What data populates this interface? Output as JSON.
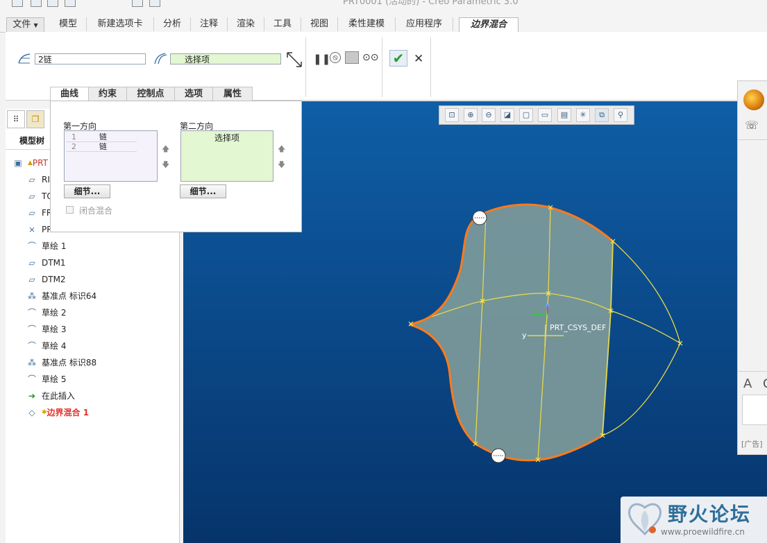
{
  "window": {
    "title": "PRT0001 (活动的) - Creo Parametric 3.0"
  },
  "ribbon_tabs": [
    {
      "label": "文件"
    },
    {
      "label": "模型"
    },
    {
      "label": "新建选项卡"
    },
    {
      "label": "分析"
    },
    {
      "label": "注释"
    },
    {
      "label": "渲染"
    },
    {
      "label": "工具"
    },
    {
      "label": "视图"
    },
    {
      "label": "柔性建模"
    },
    {
      "label": "应用程序"
    },
    {
      "label": "边界混合"
    }
  ],
  "dashboard": {
    "first_collector": "2链",
    "second_collector": "选择项"
  },
  "sub_tabs": [
    {
      "label": "曲线"
    },
    {
      "label": "约束"
    },
    {
      "label": "控制点"
    },
    {
      "label": "选项"
    },
    {
      "label": "属性"
    }
  ],
  "curves_panel": {
    "first_direction_label": "第一方向",
    "second_direction_label": "第二方向",
    "first_direction_items": [
      {
        "index": "1",
        "label": "链"
      },
      {
        "index": "2",
        "label": "链"
      }
    ],
    "second_direction_placeholder": "选择项",
    "details_label": "细节...",
    "closed_blend_label": "闭合混合"
  },
  "tree": {
    "tab_label": "模型树",
    "items": [
      {
        "label": "PRT",
        "icon": "part-icon"
      },
      {
        "label": "RI",
        "icon": "datum-plane-icon"
      },
      {
        "label": "TO",
        "icon": "datum-plane-icon"
      },
      {
        "label": "FR",
        "icon": "datum-plane-icon"
      },
      {
        "label": "PR",
        "icon": "csys-icon"
      },
      {
        "label": "草绘 1",
        "icon": "sketch-icon"
      },
      {
        "label": "DTM1",
        "icon": "datum-plane-icon"
      },
      {
        "label": "DTM2",
        "icon": "datum-plane-icon"
      },
      {
        "label": "基准点 标识64",
        "icon": "datum-point-icon"
      },
      {
        "label": "草绘 2",
        "icon": "sketch-icon"
      },
      {
        "label": "草绘 3",
        "icon": "sketch-icon"
      },
      {
        "label": "草绘 4",
        "icon": "sketch-icon"
      },
      {
        "label": "基准点 标识88",
        "icon": "datum-point-icon"
      },
      {
        "label": "草绘 5",
        "icon": "sketch-icon"
      },
      {
        "label": "在此插入",
        "icon": "insert-arrow-icon"
      },
      {
        "label": "边界混合 1",
        "icon": "boundary-blend-icon"
      }
    ]
  },
  "viewport": {
    "csys_label": "PRT_CSYS_DEF",
    "axis_label": "y"
  },
  "side_panel": {
    "ad_label": "[广告]"
  },
  "watermark": {
    "title": "野火论坛",
    "url": "www.proewildfire.cn"
  }
}
